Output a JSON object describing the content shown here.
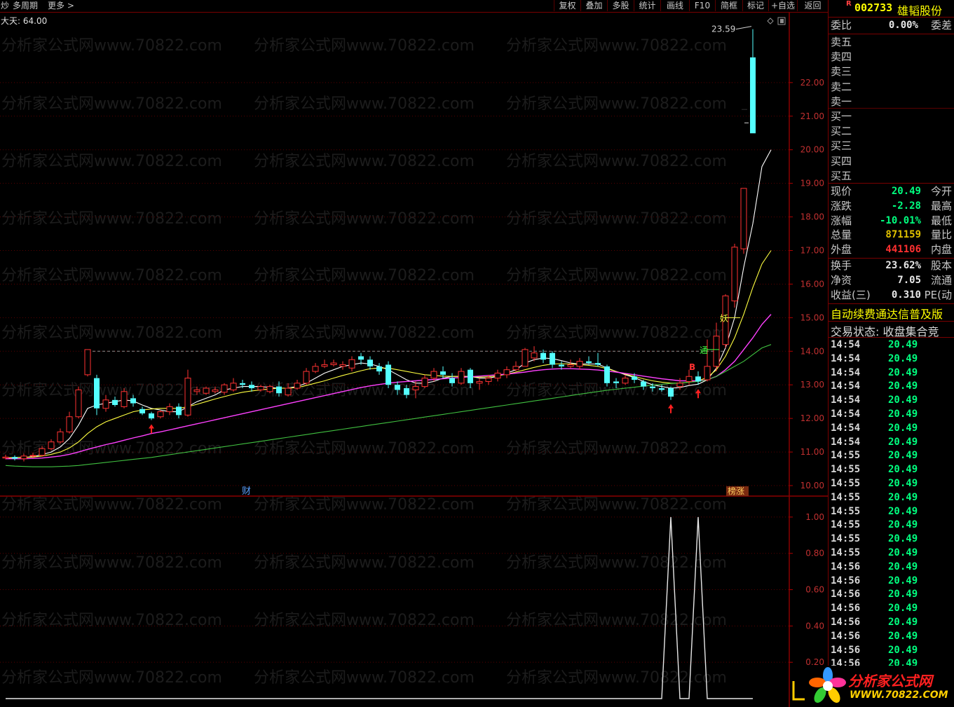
{
  "toolbar": {
    "left_items": [
      "炒",
      "多周期",
      "更多 >"
    ],
    "buttons": [
      "复权",
      "叠加",
      "多股",
      "统计",
      "画线",
      "F10",
      "简框",
      "标记",
      "+自选",
      "返回"
    ]
  },
  "chart_header": {
    "period_label": "大天: 64.00",
    "high_label": "23.59"
  },
  "watermark": "分析家公式网www.70822.com",
  "markers": {
    "cai": "财",
    "bangzhang": "榜涨",
    "yao": "妖",
    "tong": "通",
    "b": "B"
  },
  "stock": {
    "flag": "R",
    "code": "002733",
    "name": "雄韬股份"
  },
  "weibi": {
    "label": "委比",
    "value": "0.00%",
    "label2": "委差"
  },
  "orderbook": [
    "卖五",
    "卖四",
    "卖三",
    "卖二",
    "卖一",
    "买一",
    "买二",
    "买三",
    "买四",
    "买五"
  ],
  "quote": [
    {
      "label": "现价",
      "value": "20.49",
      "label2": "今开",
      "color": "#00ff7f"
    },
    {
      "label": "涨跌",
      "value": "-2.28",
      "label2": "最高",
      "color": "#00ff7f"
    },
    {
      "label": "涨幅",
      "value": "-10.01%",
      "label2": "最低",
      "color": "#00ff7f"
    },
    {
      "label": "总量",
      "value": "871159",
      "label2": "量比",
      "color": "#e0c000"
    },
    {
      "label": "外盘",
      "value": "441106",
      "label2": "内盘",
      "color": "#ff3030"
    }
  ],
  "fundamentals": [
    {
      "label": "换手",
      "value": "23.62%",
      "label2": "股本"
    },
    {
      "label": "净资",
      "value": "7.05",
      "label2": "流通"
    },
    {
      "label": "收益(三)",
      "value": "0.310",
      "label2": "PE(动"
    }
  ],
  "banner": "自动续费通达信普及版",
  "trade_status": "交易状态: 收盘集合竞",
  "ticks": [
    {
      "time": "14:54",
      "price": "20.49"
    },
    {
      "time": "14:54",
      "price": "20.49"
    },
    {
      "time": "14:54",
      "price": "20.49"
    },
    {
      "time": "14:54",
      "price": "20.49"
    },
    {
      "time": "14:54",
      "price": "20.49"
    },
    {
      "time": "14:54",
      "price": "20.49"
    },
    {
      "time": "14:54",
      "price": "20.49"
    },
    {
      "time": "14:54",
      "price": "20.49"
    },
    {
      "time": "14:55",
      "price": "20.49"
    },
    {
      "time": "14:55",
      "price": "20.49"
    },
    {
      "time": "14:55",
      "price": "20.49"
    },
    {
      "time": "14:55",
      "price": "20.49"
    },
    {
      "time": "14:55",
      "price": "20.49"
    },
    {
      "time": "14:55",
      "price": "20.49"
    },
    {
      "time": "14:55",
      "price": "20.49"
    },
    {
      "time": "14:55",
      "price": "20.49"
    },
    {
      "time": "14:56",
      "price": "20.49"
    },
    {
      "time": "14:56",
      "price": "20.49"
    },
    {
      "time": "14:56",
      "price": "20.49"
    },
    {
      "time": "14:56",
      "price": "20.49"
    },
    {
      "time": "14:56",
      "price": "20.49"
    },
    {
      "time": "14:56",
      "price": "20.49"
    },
    {
      "time": "14:56",
      "price": "20.49"
    },
    {
      "time": "14:56",
      "price": "20.49"
    }
  ],
  "logo": {
    "name": "分析家公式网",
    "url": "WWW.70822.COM"
  },
  "chart_data": {
    "type": "candlestick",
    "price_axis": {
      "ticks": [
        "22.00",
        "21.00",
        "20.00",
        "19.00",
        "18.00",
        "17.00",
        "16.00",
        "15.00",
        "14.00",
        "13.00",
        "12.00",
        "11.00",
        "10.00"
      ],
      "range": [
        9.75,
        24.0
      ]
    },
    "indicator_axis": {
      "ticks": [
        "1.00",
        "0.80",
        "0.60",
        "0.40",
        "0.20"
      ],
      "range": [
        0,
        1.1
      ]
    },
    "candles": [
      [
        10.82,
        10.85,
        10.92,
        10.78
      ],
      [
        10.85,
        10.8,
        10.9,
        10.75
      ],
      [
        10.8,
        10.88,
        10.95,
        10.72
      ],
      [
        10.88,
        10.9,
        10.98,
        10.82
      ],
      [
        10.9,
        11.1,
        11.18,
        10.86
      ],
      [
        11.1,
        11.3,
        11.38,
        11.05
      ],
      [
        11.3,
        11.6,
        11.7,
        11.25
      ],
      [
        11.6,
        12.05,
        12.2,
        11.55
      ],
      [
        12.05,
        12.85,
        12.95,
        12.0
      ],
      [
        13.3,
        14.05,
        14.05,
        13.25
      ],
      [
        13.2,
        12.3,
        13.3,
        12.1
      ],
      [
        12.3,
        12.55,
        12.7,
        12.2
      ],
      [
        12.55,
        12.4,
        12.65,
        12.35
      ],
      [
        12.35,
        12.8,
        12.9,
        12.3
      ],
      [
        12.6,
        12.45,
        12.7,
        12.35
      ],
      [
        12.28,
        12.15,
        12.35,
        12.1
      ],
      [
        12.15,
        12.0,
        12.2,
        11.95
      ],
      [
        12.05,
        12.2,
        12.25,
        12.0
      ],
      [
        12.2,
        12.35,
        12.45,
        12.1
      ],
      [
        12.35,
        12.1,
        12.45,
        12.0
      ],
      [
        12.1,
        13.2,
        13.45,
        12.05
      ],
      [
        12.8,
        12.85,
        12.95,
        12.7
      ],
      [
        12.75,
        12.9,
        12.95,
        12.7
      ],
      [
        12.8,
        12.85,
        12.95,
        12.75
      ],
      [
        12.78,
        13.0,
        13.05,
        12.7
      ],
      [
        12.85,
        13.05,
        13.2,
        12.8
      ],
      [
        13.05,
        13.0,
        13.15,
        12.9
      ],
      [
        13.0,
        12.9,
        13.1,
        12.8
      ],
      [
        12.85,
        12.95,
        13.0,
        12.8
      ],
      [
        12.8,
        12.95,
        13.0,
        12.75
      ],
      [
        12.95,
        12.75,
        13.1,
        12.65
      ],
      [
        12.7,
        12.9,
        13.05,
        12.65
      ],
      [
        12.9,
        13.05,
        13.15,
        12.85
      ],
      [
        13.05,
        13.4,
        13.5,
        13.0
      ],
      [
        13.4,
        13.55,
        13.65,
        13.35
      ],
      [
        13.55,
        13.6,
        13.75,
        13.5
      ],
      [
        13.6,
        13.65,
        13.75,
        13.55
      ],
      [
        13.55,
        13.6,
        13.7,
        13.45
      ],
      [
        13.5,
        13.75,
        13.85,
        13.4
      ],
      [
        13.85,
        13.75,
        13.95,
        13.6
      ],
      [
        13.75,
        13.55,
        13.85,
        13.45
      ],
      [
        13.55,
        13.4,
        13.65,
        13.3
      ],
      [
        13.6,
        13.0,
        13.7,
        12.9
      ],
      [
        13.0,
        12.85,
        13.1,
        12.7
      ],
      [
        12.9,
        12.7,
        13.0,
        12.6
      ],
      [
        12.85,
        12.95,
        13.1,
        12.6
      ],
      [
        12.95,
        13.2,
        13.3,
        12.9
      ],
      [
        13.2,
        13.4,
        13.5,
        13.1
      ],
      [
        13.4,
        13.3,
        13.55,
        13.2
      ],
      [
        13.2,
        13.05,
        13.35,
        12.95
      ],
      [
        13.05,
        13.4,
        13.5,
        13.0
      ],
      [
        13.45,
        13.05,
        13.5,
        12.9
      ],
      [
        13.05,
        13.1,
        13.2,
        12.85
      ],
      [
        13.1,
        13.2,
        13.3,
        13.0
      ],
      [
        13.2,
        13.35,
        13.45,
        13.1
      ],
      [
        13.3,
        13.45,
        13.55,
        13.2
      ],
      [
        13.45,
        13.55,
        13.7,
        13.4
      ],
      [
        13.55,
        14.05,
        14.1,
        13.55
      ],
      [
        13.8,
        13.95,
        14.15,
        13.7
      ],
      [
        13.95,
        13.75,
        14.05,
        13.65
      ],
      [
        13.95,
        13.6,
        14.0,
        13.5
      ],
      [
        13.6,
        13.55,
        13.7,
        13.45
      ],
      [
        13.55,
        13.6,
        13.75,
        13.5
      ],
      [
        13.55,
        13.7,
        13.8,
        13.45
      ],
      [
        13.7,
        13.65,
        13.85,
        13.6
      ],
      [
        13.65,
        13.6,
        13.95,
        13.55
      ],
      [
        13.55,
        13.05,
        13.6,
        12.95
      ],
      [
        13.1,
        13.05,
        13.2,
        12.9
      ],
      [
        13.05,
        13.2,
        13.3,
        13.0
      ],
      [
        13.25,
        13.15,
        13.35,
        13.05
      ],
      [
        13.1,
        12.95,
        13.15,
        12.85
      ],
      [
        12.95,
        12.9,
        13.05,
        12.8
      ],
      [
        12.9,
        12.85,
        13.0,
        12.8
      ],
      [
        12.9,
        12.65,
        12.95,
        12.55
      ],
      [
        12.95,
        13.05,
        13.2,
        12.85
      ],
      [
        13.1,
        13.25,
        13.45,
        13.0
      ],
      [
        13.25,
        13.1,
        13.4,
        13.0
      ],
      [
        13.15,
        13.55,
        14.35,
        13.1
      ],
      [
        13.55,
        14.45,
        14.85,
        13.4
      ],
      [
        14.2,
        15.65,
        15.7,
        14.1
      ],
      [
        15.5,
        17.1,
        17.2,
        15.3
      ],
      [
        17.05,
        18.85,
        18.85,
        16.9
      ],
      [
        22.75,
        20.49,
        23.59,
        20.49
      ]
    ],
    "ma_series": [
      {
        "name": "",
        "color": "#ffffff",
        "values": [
          10.82,
          10.84,
          10.84,
          10.86,
          10.92,
          11.0,
          11.15,
          11.4,
          11.8,
          12.3,
          12.4,
          12.45,
          12.5,
          12.55,
          12.52,
          12.4,
          12.3,
          12.25,
          12.2,
          12.2,
          12.35,
          12.5,
          12.6,
          12.7,
          12.85,
          12.9,
          12.95,
          12.95,
          12.95,
          12.92,
          12.9,
          12.9,
          12.95,
          13.05,
          13.2,
          13.35,
          13.45,
          13.55,
          13.6,
          13.65,
          13.62,
          13.55,
          13.45,
          13.3,
          13.15,
          13.05,
          13.05,
          13.1,
          13.2,
          13.25,
          13.25,
          13.25,
          13.2,
          13.2,
          13.25,
          13.35,
          13.45,
          13.65,
          13.75,
          13.8,
          13.78,
          13.72,
          13.65,
          13.62,
          13.62,
          13.62,
          13.5,
          13.4,
          13.3,
          13.22,
          13.1,
          13.0,
          12.95,
          12.9,
          12.92,
          12.98,
          13.02,
          13.15,
          13.5,
          14.1,
          15.0,
          16.5,
          17.8,
          19.5,
          20.0
        ]
      },
      {
        "name": "",
        "color": "#ffff40",
        "values": [
          10.82,
          10.83,
          10.84,
          10.85,
          10.88,
          10.93,
          11.0,
          11.12,
          11.3,
          11.55,
          11.75,
          11.9,
          12.0,
          12.1,
          12.2,
          12.25,
          12.28,
          12.3,
          12.3,
          12.3,
          12.35,
          12.42,
          12.5,
          12.58,
          12.65,
          12.72,
          12.78,
          12.82,
          12.85,
          12.88,
          12.9,
          12.9,
          12.92,
          12.98,
          13.05,
          13.12,
          13.2,
          13.28,
          13.35,
          13.42,
          13.48,
          13.5,
          13.5,
          13.45,
          13.4,
          13.35,
          13.3,
          13.28,
          13.26,
          13.25,
          13.25,
          13.24,
          13.23,
          13.24,
          13.27,
          13.32,
          13.38,
          13.45,
          13.52,
          13.58,
          13.62,
          13.63,
          13.62,
          13.6,
          13.58,
          13.55,
          13.48,
          13.4,
          13.32,
          13.25,
          13.18,
          13.12,
          13.08,
          13.05,
          13.05,
          13.08,
          13.12,
          13.22,
          13.45,
          13.85,
          14.4,
          15.1,
          15.9,
          16.6,
          17.0
        ]
      },
      {
        "name": "",
        "color": "#ff40ff",
        "values": [
          10.8,
          10.8,
          10.8,
          10.81,
          10.82,
          10.85,
          10.88,
          10.93,
          11.0,
          11.08,
          11.15,
          11.22,
          11.28,
          11.35,
          11.42,
          11.48,
          11.55,
          11.6,
          11.66,
          11.72,
          11.78,
          11.84,
          11.9,
          11.96,
          12.02,
          12.08,
          12.14,
          12.2,
          12.26,
          12.32,
          12.38,
          12.44,
          12.5,
          12.56,
          12.62,
          12.68,
          12.74,
          12.8,
          12.86,
          12.92,
          12.97,
          13.01,
          13.05,
          13.08,
          13.1,
          13.12,
          13.14,
          13.16,
          13.18,
          13.2,
          13.22,
          13.24,
          13.26,
          13.28,
          13.3,
          13.32,
          13.35,
          13.38,
          13.42,
          13.45,
          13.47,
          13.48,
          13.48,
          13.47,
          13.46,
          13.44,
          13.41,
          13.38,
          13.34,
          13.3,
          13.26,
          13.22,
          13.18,
          13.15,
          13.12,
          13.12,
          13.12,
          13.15,
          13.25,
          13.45,
          13.7,
          14.05,
          14.4,
          14.8,
          15.1
        ]
      },
      {
        "name": "",
        "color": "#40c040",
        "values": [
          10.6,
          10.58,
          10.57,
          10.56,
          10.56,
          10.56,
          10.57,
          10.58,
          10.6,
          10.63,
          10.66,
          10.69,
          10.72,
          10.75,
          10.78,
          10.81,
          10.84,
          10.88,
          10.92,
          10.96,
          11.0,
          11.04,
          11.08,
          11.12,
          11.16,
          11.2,
          11.24,
          11.28,
          11.32,
          11.36,
          11.4,
          11.44,
          11.48,
          11.52,
          11.56,
          11.6,
          11.64,
          11.68,
          11.72,
          11.76,
          11.8,
          11.84,
          11.88,
          11.92,
          11.96,
          12.0,
          12.04,
          12.08,
          12.12,
          12.16,
          12.2,
          12.24,
          12.28,
          12.32,
          12.36,
          12.4,
          12.44,
          12.48,
          12.52,
          12.56,
          12.6,
          12.64,
          12.68,
          12.72,
          12.76,
          12.8,
          12.84,
          12.87,
          12.9,
          12.93,
          12.96,
          12.99,
          13.02,
          13.04,
          13.06,
          13.08,
          13.1,
          13.15,
          13.25,
          13.4,
          13.55,
          13.7,
          13.9,
          14.1,
          14.2
        ]
      }
    ],
    "signal_arrows": [
      16,
      73,
      76
    ],
    "reference_price": 14.0,
    "indicator": [
      {
        "x": 72,
        "value": 0
      },
      {
        "x": 73,
        "value": 1
      },
      {
        "x": 74,
        "value": 0
      },
      {
        "x": 75,
        "value": 0
      },
      {
        "x": 76,
        "value": 1
      },
      {
        "x": 77,
        "value": 0
      }
    ]
  }
}
